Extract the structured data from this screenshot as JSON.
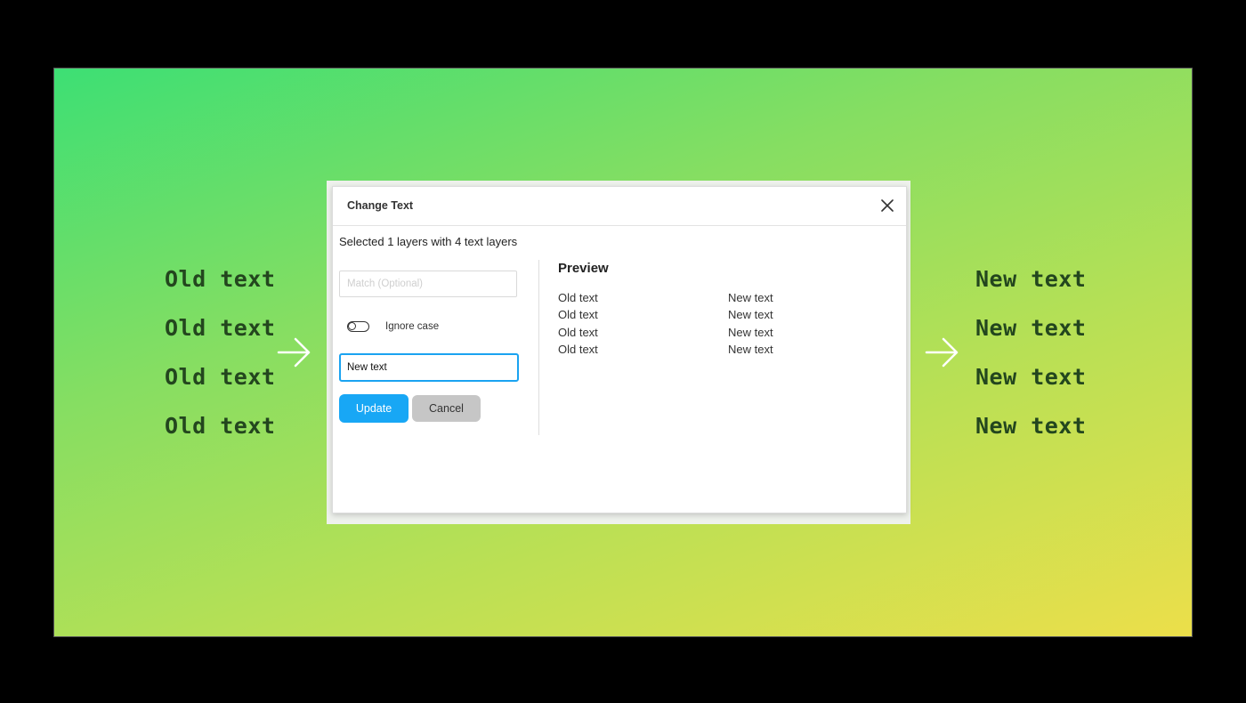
{
  "left_labels": [
    "Old text",
    "Old text",
    "Old text",
    "Old text"
  ],
  "right_labels": [
    "New text",
    "New text",
    "New text",
    "New text"
  ],
  "dialog": {
    "title": "Change Text",
    "summary": "Selected 1 layers with 4 text layers",
    "match_placeholder": "Match (Optional)",
    "match_value": "",
    "ignore_case_label": "Ignore case",
    "ignore_case_on": false,
    "replace_value": "New text",
    "update_label": "Update",
    "cancel_label": "Cancel",
    "preview_title": "Preview",
    "preview": [
      {
        "old": "Old text",
        "new": "New text"
      },
      {
        "old": "Old text",
        "new": "New text"
      },
      {
        "old": "Old text",
        "new": "New text"
      },
      {
        "old": "Old text",
        "new": "New text"
      }
    ]
  },
  "colors": {
    "accent": "#18a7f5",
    "label_text": "#23461e",
    "background_gradient": [
      "#3ddf74",
      "#ecdf4a"
    ]
  },
  "icons": [
    "arrow-right-icon",
    "close-icon",
    "toggle-switch"
  ]
}
